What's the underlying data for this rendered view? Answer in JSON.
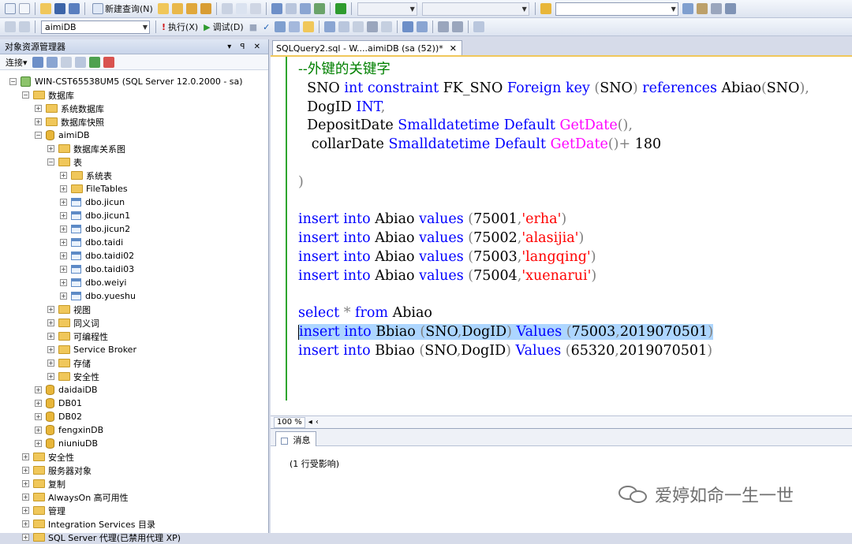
{
  "toolbar1": {
    "new_query": "新建查询(N)",
    "combo_blank_1": "",
    "combo_blank_2": "",
    "combo_blank_3": ""
  },
  "toolbar2": {
    "database_value": "aimiDB",
    "execute_label": "执行(X)",
    "debug_label": "调试(D)"
  },
  "object_explorer": {
    "title": "对象资源管理器",
    "pane_controls": "▾ ꟼ ✕",
    "connect_label": "连接▾",
    "tree": [
      {
        "label": "WIN-CST65538UM5 (SQL Server 12.0.2000 - sa)",
        "icon": "server-icon",
        "expand": "−"
      },
      {
        "label": "数据库",
        "icon": "folder-icon",
        "expand": "−"
      },
      {
        "label": "系统数据库",
        "icon": "folder-icon",
        "expand": "+"
      },
      {
        "label": "数据库快照",
        "icon": "folder-icon",
        "expand": "+"
      },
      {
        "label": "aimiDB",
        "icon": "database-icon",
        "expand": "−"
      },
      {
        "label": "数据库关系图",
        "icon": "folder-icon",
        "expand": "+"
      },
      {
        "label": "表",
        "icon": "folder-icon",
        "expand": "−"
      },
      {
        "label": "系统表",
        "icon": "folder-icon",
        "expand": "+"
      },
      {
        "label": "FileTables",
        "icon": "folder-icon",
        "expand": "+"
      },
      {
        "label": "dbo.jicun",
        "icon": "table-icon",
        "expand": "+"
      },
      {
        "label": "dbo.jicun1",
        "icon": "table-icon",
        "expand": "+"
      },
      {
        "label": "dbo.jicun2",
        "icon": "table-icon",
        "expand": "+"
      },
      {
        "label": "dbo.taidi",
        "icon": "table-icon",
        "expand": "+"
      },
      {
        "label": "dbo.taidi02",
        "icon": "table-icon",
        "expand": "+"
      },
      {
        "label": "dbo.taidi03",
        "icon": "table-icon",
        "expand": "+"
      },
      {
        "label": "dbo.weiyi",
        "icon": "table-icon",
        "expand": "+"
      },
      {
        "label": "dbo.yueshu",
        "icon": "table-icon",
        "expand": "+"
      },
      {
        "label": "视图",
        "icon": "folder-icon",
        "expand": "+"
      },
      {
        "label": "同义词",
        "icon": "folder-icon",
        "expand": "+"
      },
      {
        "label": "可编程性",
        "icon": "folder-icon",
        "expand": "+"
      },
      {
        "label": "Service Broker",
        "icon": "folder-icon",
        "expand": "+"
      },
      {
        "label": "存储",
        "icon": "folder-icon",
        "expand": "+"
      },
      {
        "label": "安全性",
        "icon": "folder-icon",
        "expand": "+"
      },
      {
        "label": "daidaiDB",
        "icon": "database-icon",
        "expand": "+"
      },
      {
        "label": "DB01",
        "icon": "database-icon",
        "expand": "+"
      },
      {
        "label": "DB02",
        "icon": "database-icon",
        "expand": "+"
      },
      {
        "label": "fengxinDB",
        "icon": "database-icon",
        "expand": "+"
      },
      {
        "label": "niuniuDB",
        "icon": "database-icon",
        "expand": "+"
      },
      {
        "label": "安全性",
        "icon": "folder-icon",
        "expand": "+"
      },
      {
        "label": "服务器对象",
        "icon": "folder-icon",
        "expand": "+"
      },
      {
        "label": "复制",
        "icon": "folder-icon",
        "expand": "+"
      },
      {
        "label": "AlwaysOn 高可用性",
        "icon": "folder-icon",
        "expand": "+"
      },
      {
        "label": "管理",
        "icon": "folder-icon",
        "expand": "+"
      },
      {
        "label": "Integration Services 目录",
        "icon": "folder-icon",
        "expand": "+"
      },
      {
        "label": "SQL Server 代理(已禁用代理 XP)",
        "icon": "folder-icon",
        "expand": "+"
      }
    ]
  },
  "document": {
    "tab_title": "SQLQuery2.sql - W....aimiDB (sa (52))*",
    "tab_close": "✕",
    "code_lines": [
      [
        {
          "t": "--外键的关键字",
          "c": "cm"
        }
      ],
      [
        {
          "t": "  SNO ",
          "c": ""
        },
        {
          "t": "int",
          "c": "kw"
        },
        {
          "t": " ",
          "c": ""
        },
        {
          "t": "constraint",
          "c": "kw"
        },
        {
          "t": " FK_SNO ",
          "c": ""
        },
        {
          "t": "Foreign key",
          "c": "kw"
        },
        {
          "t": " (",
          "c": "gr"
        },
        {
          "t": "SNO",
          "c": ""
        },
        {
          "t": ")",
          "c": "gr"
        },
        {
          "t": " ",
          "c": ""
        },
        {
          "t": "references",
          "c": "kw"
        },
        {
          "t": " Abiao",
          "c": ""
        },
        {
          "t": "(",
          "c": "gr"
        },
        {
          "t": "SNO",
          "c": ""
        },
        {
          "t": "),",
          "c": "gr"
        }
      ],
      [
        {
          "t": "  DogID ",
          "c": ""
        },
        {
          "t": "INT",
          "c": "kw"
        },
        {
          "t": ",",
          "c": "gr"
        }
      ],
      [
        {
          "t": "  DepositDate ",
          "c": ""
        },
        {
          "t": "Smalldatetime",
          "c": "kw"
        },
        {
          "t": " ",
          "c": ""
        },
        {
          "t": "Default",
          "c": "kw"
        },
        {
          "t": " ",
          "c": ""
        },
        {
          "t": "GetDate",
          "c": "fn"
        },
        {
          "t": "(),",
          "c": "gr"
        }
      ],
      [
        {
          "t": "   collarDate ",
          "c": ""
        },
        {
          "t": "Smalldatetime",
          "c": "kw"
        },
        {
          "t": " ",
          "c": ""
        },
        {
          "t": "Default",
          "c": "kw"
        },
        {
          "t": " ",
          "c": ""
        },
        {
          "t": "GetDate",
          "c": "fn"
        },
        {
          "t": "()+",
          "c": "gr"
        },
        {
          "t": " 180",
          "c": ""
        }
      ],
      [],
      [
        {
          "t": ")",
          "c": "gr"
        }
      ],
      [],
      [
        {
          "t": "insert",
          "c": "kw"
        },
        {
          "t": " ",
          "c": ""
        },
        {
          "t": "into",
          "c": "kw"
        },
        {
          "t": " Abiao ",
          "c": ""
        },
        {
          "t": "values",
          "c": "kw"
        },
        {
          "t": " (",
          "c": "gr"
        },
        {
          "t": "75001",
          "c": ""
        },
        {
          "t": ",",
          "c": "gr"
        },
        {
          "t": "'erha'",
          "c": "str"
        },
        {
          "t": ")",
          "c": "gr"
        }
      ],
      [
        {
          "t": "insert",
          "c": "kw"
        },
        {
          "t": " ",
          "c": ""
        },
        {
          "t": "into",
          "c": "kw"
        },
        {
          "t": " Abiao ",
          "c": ""
        },
        {
          "t": "values",
          "c": "kw"
        },
        {
          "t": " (",
          "c": "gr"
        },
        {
          "t": "75002",
          "c": ""
        },
        {
          "t": ",",
          "c": "gr"
        },
        {
          "t": "'alasijia'",
          "c": "str"
        },
        {
          "t": ")",
          "c": "gr"
        }
      ],
      [
        {
          "t": "insert",
          "c": "kw"
        },
        {
          "t": " ",
          "c": ""
        },
        {
          "t": "into",
          "c": "kw"
        },
        {
          "t": " Abiao ",
          "c": ""
        },
        {
          "t": "values",
          "c": "kw"
        },
        {
          "t": " (",
          "c": "gr"
        },
        {
          "t": "75003",
          "c": ""
        },
        {
          "t": ",",
          "c": "gr"
        },
        {
          "t": "'langqing'",
          "c": "str"
        },
        {
          "t": ")",
          "c": "gr"
        }
      ],
      [
        {
          "t": "insert",
          "c": "kw"
        },
        {
          "t": " ",
          "c": ""
        },
        {
          "t": "into",
          "c": "kw"
        },
        {
          "t": " Abiao ",
          "c": ""
        },
        {
          "t": "values",
          "c": "kw"
        },
        {
          "t": " (",
          "c": "gr"
        },
        {
          "t": "75004",
          "c": ""
        },
        {
          "t": ",",
          "c": "gr"
        },
        {
          "t": "'xuenarui'",
          "c": "str"
        },
        {
          "t": ")",
          "c": "gr"
        }
      ],
      [],
      [
        {
          "t": "select",
          "c": "kw"
        },
        {
          "t": " * ",
          "c": "gr"
        },
        {
          "t": "from",
          "c": "kw"
        },
        {
          "t": " Abiao",
          "c": ""
        }
      ],
      [
        {
          "t": "insert",
          "c": "kw hl"
        },
        {
          "t": " ",
          "c": "hl"
        },
        {
          "t": "into",
          "c": "kw hl"
        },
        {
          "t": " Bbiao ",
          "c": "hl"
        },
        {
          "t": "(",
          "c": "gr hl"
        },
        {
          "t": "SNO",
          "c": "hl"
        },
        {
          "t": ",",
          "c": "gr hl"
        },
        {
          "t": "DogID",
          "c": "hl"
        },
        {
          "t": ")",
          "c": "gr hl"
        },
        {
          "t": " ",
          "c": "hl"
        },
        {
          "t": "Values",
          "c": "kw hl"
        },
        {
          "t": " (",
          "c": "gr hl"
        },
        {
          "t": "75003",
          "c": "hl"
        },
        {
          "t": ",",
          "c": "gr hl"
        },
        {
          "t": "2019070501",
          "c": "hl"
        },
        {
          "t": ")",
          "c": "gr hl"
        }
      ],
      [
        {
          "t": "insert",
          "c": "kw"
        },
        {
          "t": " ",
          "c": ""
        },
        {
          "t": "into",
          "c": "kw"
        },
        {
          "t": " Bbiao ",
          "c": ""
        },
        {
          "t": "(",
          "c": "gr"
        },
        {
          "t": "SNO",
          "c": ""
        },
        {
          "t": ",",
          "c": "gr"
        },
        {
          "t": "DogID",
          "c": ""
        },
        {
          "t": ")",
          "c": "gr"
        },
        {
          "t": " ",
          "c": ""
        },
        {
          "t": "Values",
          "c": "kw"
        },
        {
          "t": " (",
          "c": "gr"
        },
        {
          "t": "65320",
          "c": ""
        },
        {
          "t": ",",
          "c": "gr"
        },
        {
          "t": "2019070501",
          "c": ""
        },
        {
          "t": ")",
          "c": "gr"
        }
      ]
    ],
    "zoom": "100 %"
  },
  "results": {
    "tab_label": "消息",
    "message": "(1 行受影响)"
  },
  "watermark": {
    "text": "爱婷如命一生一世"
  },
  "colors": {
    "keyword": "#0000ff",
    "function": "#ff00ff",
    "string": "#ff0000",
    "comment": "#008000",
    "selection": "#add6ff",
    "change_bar": "#2ea52e"
  }
}
